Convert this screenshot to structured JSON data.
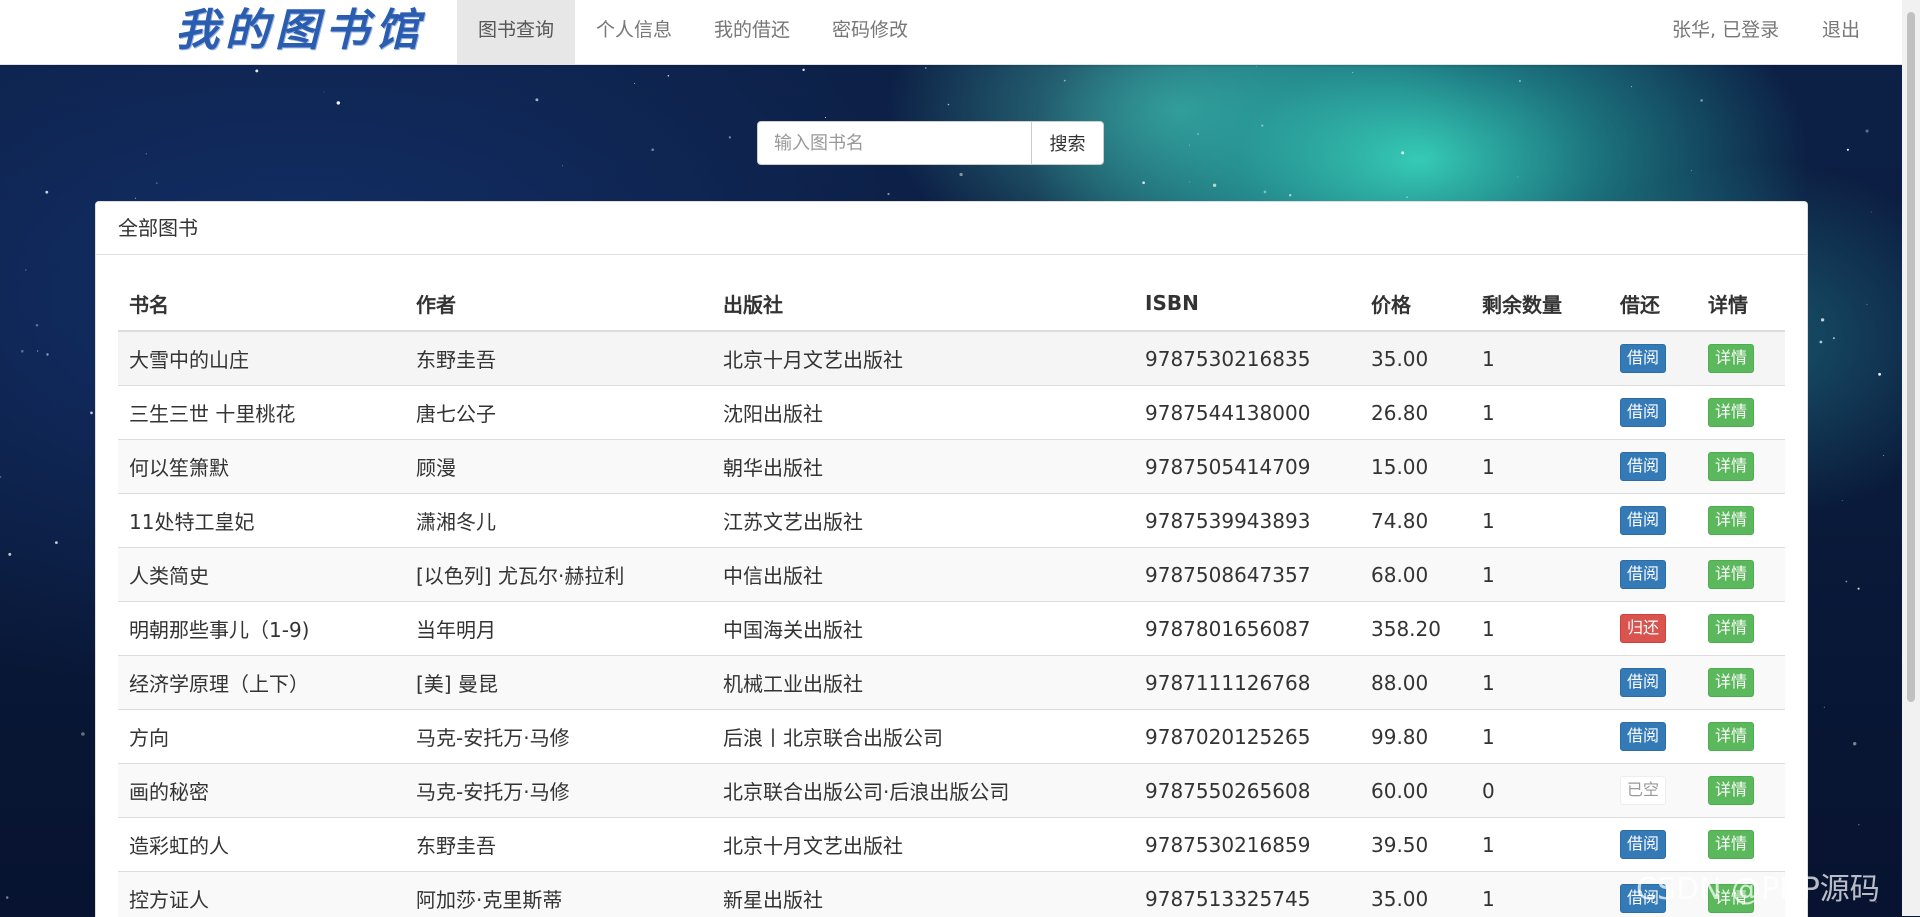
{
  "nav": {
    "brand": "我的图书馆",
    "items": [
      {
        "label": "图书查询",
        "active": true
      },
      {
        "label": "个人信息",
        "active": false
      },
      {
        "label": "我的借还",
        "active": false
      },
      {
        "label": "密码修改",
        "active": false
      }
    ],
    "user_status": "张华, 已登录",
    "logout": "退出"
  },
  "search": {
    "placeholder": "输入图书名",
    "button": "搜索"
  },
  "panel": {
    "title": "全部图书",
    "columns": [
      "书名",
      "作者",
      "出版社",
      "ISBN",
      "价格",
      "剩余数量",
      "借还",
      "详情"
    ],
    "rows": [
      {
        "title": "大雪中的山庄",
        "author": "东野圭吾",
        "publisher": "北京十月文艺出版社",
        "isbn": "9787530216835",
        "price": "35.00",
        "stock": "1",
        "action": "借阅",
        "action_type": "borrow",
        "detail": "详情"
      },
      {
        "title": "三生三世 十里桃花",
        "author": "唐七公子",
        "publisher": "沈阳出版社",
        "isbn": "9787544138000",
        "price": "26.80",
        "stock": "1",
        "action": "借阅",
        "action_type": "borrow",
        "detail": "详情"
      },
      {
        "title": "何以笙箫默",
        "author": "顾漫",
        "publisher": "朝华出版社",
        "isbn": "9787505414709",
        "price": "15.00",
        "stock": "1",
        "action": "借阅",
        "action_type": "borrow",
        "detail": "详情"
      },
      {
        "title": "11处特工皇妃",
        "author": "潇湘冬儿",
        "publisher": "江苏文艺出版社",
        "isbn": "9787539943893",
        "price": "74.80",
        "stock": "1",
        "action": "借阅",
        "action_type": "borrow",
        "detail": "详情"
      },
      {
        "title": "人类简史",
        "author": "[以色列] 尤瓦尔·赫拉利",
        "publisher": "中信出版社",
        "isbn": "9787508647357",
        "price": "68.00",
        "stock": "1",
        "action": "借阅",
        "action_type": "borrow",
        "detail": "详情"
      },
      {
        "title": "明朝那些事儿（1-9)",
        "author": "当年明月",
        "publisher": "中国海关出版社",
        "isbn": "9787801656087",
        "price": "358.20",
        "stock": "1",
        "action": "归还",
        "action_type": "return",
        "detail": "详情"
      },
      {
        "title": "经济学原理（上下）",
        "author": "[美] 曼昆",
        "publisher": "机械工业出版社",
        "isbn": "9787111126768",
        "price": "88.00",
        "stock": "1",
        "action": "借阅",
        "action_type": "borrow",
        "detail": "详情"
      },
      {
        "title": "方向",
        "author": "马克-安托万·马修",
        "publisher": "后浪丨北京联合出版公司",
        "isbn": "9787020125265",
        "price": "99.80",
        "stock": "1",
        "action": "借阅",
        "action_type": "borrow",
        "detail": "详情"
      },
      {
        "title": "画的秘密",
        "author": "马克-安托万·马修",
        "publisher": "北京联合出版公司·后浪出版公司",
        "isbn": "9787550265608",
        "price": "60.00",
        "stock": "0",
        "action": "已空",
        "action_type": "empty",
        "detail": "详情"
      },
      {
        "title": "造彩虹的人",
        "author": "东野圭吾",
        "publisher": "北京十月文艺出版社",
        "isbn": "9787530216859",
        "price": "39.50",
        "stock": "1",
        "action": "借阅",
        "action_type": "borrow",
        "detail": "详情"
      },
      {
        "title": "控方证人",
        "author": "阿加莎·克里斯蒂",
        "publisher": "新星出版社",
        "isbn": "9787513325745",
        "price": "35.00",
        "stock": "1",
        "action": "借阅",
        "action_type": "borrow",
        "detail": "详情"
      }
    ]
  },
  "watermark": "CSDN @PHP源码",
  "colors": {
    "borrow": "#337ab7",
    "return": "#d9534f",
    "detail": "#5cb85c",
    "brand": "#2a5db0"
  }
}
